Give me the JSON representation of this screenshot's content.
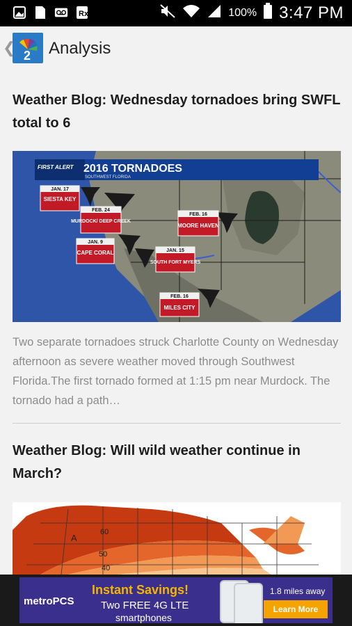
{
  "status_bar": {
    "battery_percent": "100%",
    "time": "3:47 PM"
  },
  "app_bar": {
    "title": "Analysis"
  },
  "articles": [
    {
      "title": "Weather Blog: Wednesday tornadoes bring SWFL total to 6",
      "summary": "Two separate tornadoes struck Charlotte County on Wednesday afternoon as severe weather moved through Southwest Florida.The first tornado formed at 1:15 pm near Murdock. The tornado had a path…",
      "image": {
        "header": "2016 TORNADOES",
        "subheader": "SOUTHWEST FLORIDA",
        "badge": "FIRST ALERT",
        "labels": [
          {
            "date": "JAN. 17",
            "place": "SIESTA KEY"
          },
          {
            "date": "FEB. 24",
            "place": "MURDOCK/ DEEP CREEK"
          },
          {
            "date": "JAN. 9",
            "place": "CAPE CORAL"
          },
          {
            "date": "FEB. 16",
            "place": "MOORE HAVEN"
          },
          {
            "date": "JAN. 15",
            "place": "SOUTH FORT MYERS"
          },
          {
            "date": "FEB. 16",
            "place": "MILES CITY"
          }
        ]
      }
    },
    {
      "title": "Weather Blog: Will wild weather continue in March?",
      "image": {
        "contour_labels": [
          "50",
          "60",
          "40",
          "A"
        ]
      }
    }
  ],
  "ad": {
    "brand": "metroPCS",
    "headline": "Instant Savings!",
    "line1": "Two FREE 4G LTE",
    "line2": "smartphones",
    "distance": "1.8 miles away",
    "cta": "Learn More"
  },
  "colors": {
    "accent_blue": "#2a7bc6",
    "label_red": "#c21a26",
    "ad_purple": "#3b2f8e",
    "ad_orange": "#f5a300"
  }
}
